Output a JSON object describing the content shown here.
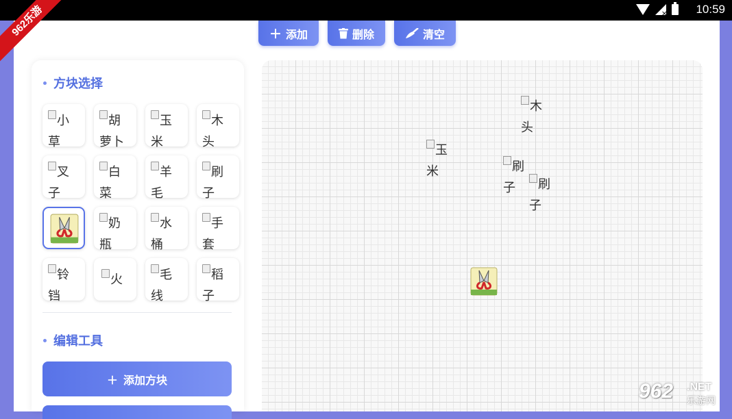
{
  "status_bar": {
    "time": "10:59"
  },
  "watermark": {
    "ribbon": "962乐游",
    "logo_num": "962",
    "logo_net": ".NET",
    "logo_cn": "乐游网"
  },
  "toolbar": {
    "add": "添加",
    "delete": "删除",
    "clear": "清空"
  },
  "sidebar": {
    "block_select_title": "方块选择",
    "edit_tools_title": "编辑工具",
    "add_block_label": "添加方块",
    "tiles": [
      {
        "alt_line1": "小",
        "alt_line2": "草",
        "icon": "broken-image-icon"
      },
      {
        "alt_line1": "胡",
        "alt_line2": "萝卜",
        "icon": "broken-image-icon"
      },
      {
        "alt_line1": "玉",
        "alt_line2": "米",
        "icon": "broken-image-icon"
      },
      {
        "alt_line1": "木",
        "alt_line2": "头",
        "icon": "broken-image-icon"
      },
      {
        "alt_line1": "叉",
        "alt_line2": "子",
        "icon": "broken-image-icon"
      },
      {
        "alt_line1": "白",
        "alt_line2": "菜",
        "icon": "broken-image-icon"
      },
      {
        "alt_line1": "羊",
        "alt_line2": "毛",
        "icon": "broken-image-icon"
      },
      {
        "alt_line1": "刷",
        "alt_line2": "子",
        "icon": "broken-image-icon"
      },
      {
        "alt_line1": "",
        "alt_line2": "",
        "icon": "shears-icon",
        "selected": true
      },
      {
        "alt_line1": "奶",
        "alt_line2": "瓶",
        "icon": "broken-image-icon"
      },
      {
        "alt_line1": "水",
        "alt_line2": "桶",
        "icon": "broken-image-icon"
      },
      {
        "alt_line1": "手",
        "alt_line2": "套",
        "icon": "broken-image-icon"
      },
      {
        "alt_line1": "铃",
        "alt_line2": "铛",
        "icon": "broken-image-icon"
      },
      {
        "alt_line1": "火",
        "alt_line2": "",
        "icon": "broken-image-icon"
      },
      {
        "alt_line1": "毛",
        "alt_line2": "线",
        "icon": "broken-image-icon"
      },
      {
        "alt_line1": "稻",
        "alt_line2": "子",
        "icon": "broken-image-icon"
      }
    ]
  },
  "canvas": {
    "placed": [
      {
        "alt_line1": "木",
        "alt_line2": "头"
      },
      {
        "alt_line1": "玉",
        "alt_line2": "米"
      },
      {
        "alt_line1": "刷",
        "alt_line2": "子"
      },
      {
        "alt_line1": "刷",
        "alt_line2": "子"
      }
    ]
  },
  "colors": {
    "accent": "#5873e8",
    "accent_light": "#7d93f3",
    "title": "#5470e0"
  }
}
